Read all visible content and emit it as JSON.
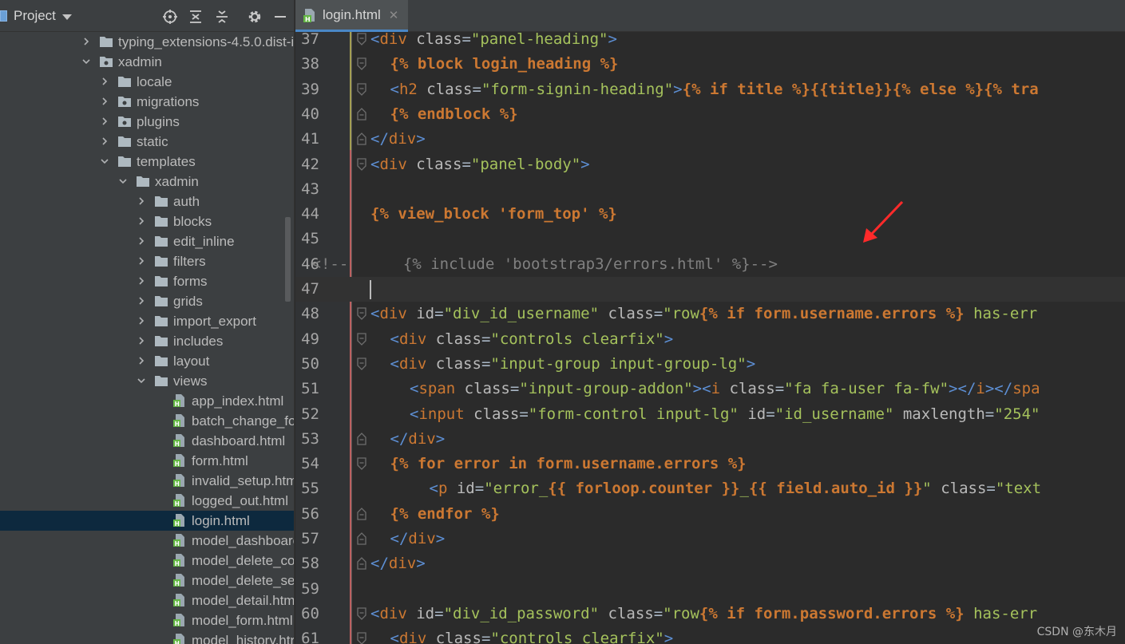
{
  "project_panel": {
    "title": "Project",
    "tree": [
      {
        "label": "typing_extensions-4.5.0.dist-i",
        "kind": "folder",
        "depth": 0,
        "expanded": false
      },
      {
        "label": "xadmin",
        "kind": "package",
        "depth": 0,
        "expanded": true
      },
      {
        "label": "locale",
        "kind": "folder",
        "depth": 1,
        "expanded": false
      },
      {
        "label": "migrations",
        "kind": "package",
        "depth": 1,
        "expanded": false
      },
      {
        "label": "plugins",
        "kind": "package",
        "depth": 1,
        "expanded": false
      },
      {
        "label": "static",
        "kind": "folder",
        "depth": 1,
        "expanded": false
      },
      {
        "label": "templates",
        "kind": "folder",
        "depth": 1,
        "expanded": true
      },
      {
        "label": "xadmin",
        "kind": "folder",
        "depth": 2,
        "expanded": true
      },
      {
        "label": "auth",
        "kind": "folder",
        "depth": 3,
        "expanded": false
      },
      {
        "label": "blocks",
        "kind": "folder",
        "depth": 3,
        "expanded": false
      },
      {
        "label": "edit_inline",
        "kind": "folder",
        "depth": 3,
        "expanded": false
      },
      {
        "label": "filters",
        "kind": "folder",
        "depth": 3,
        "expanded": false
      },
      {
        "label": "forms",
        "kind": "folder",
        "depth": 3,
        "expanded": false
      },
      {
        "label": "grids",
        "kind": "folder",
        "depth": 3,
        "expanded": false
      },
      {
        "label": "import_export",
        "kind": "folder",
        "depth": 3,
        "expanded": false
      },
      {
        "label": "includes",
        "kind": "folder",
        "depth": 3,
        "expanded": false
      },
      {
        "label": "layout",
        "kind": "folder",
        "depth": 3,
        "expanded": false
      },
      {
        "label": "views",
        "kind": "folder",
        "depth": 3,
        "expanded": true
      },
      {
        "label": "app_index.html",
        "kind": "html",
        "depth": 4
      },
      {
        "label": "batch_change_fo",
        "kind": "html",
        "depth": 4
      },
      {
        "label": "dashboard.html",
        "kind": "html",
        "depth": 4
      },
      {
        "label": "form.html",
        "kind": "html",
        "depth": 4
      },
      {
        "label": "invalid_setup.htm",
        "kind": "html",
        "depth": 4
      },
      {
        "label": "logged_out.html",
        "kind": "html",
        "depth": 4
      },
      {
        "label": "login.html",
        "kind": "html",
        "depth": 4,
        "selected": true
      },
      {
        "label": "model_dashboarc",
        "kind": "html",
        "depth": 4
      },
      {
        "label": "model_delete_cor",
        "kind": "html",
        "depth": 4
      },
      {
        "label": "model_delete_sel",
        "kind": "html",
        "depth": 4
      },
      {
        "label": "model_detail.htm",
        "kind": "html",
        "depth": 4
      },
      {
        "label": "model_form.html",
        "kind": "html",
        "depth": 4
      },
      {
        "label": "model_history.htr",
        "kind": "html",
        "depth": 4
      }
    ]
  },
  "editor": {
    "tab_label": "login.html",
    "tab_close": "✕",
    "current_line": 47,
    "lines": [
      {
        "n": "37",
        "indent": 0,
        "tokens": [
          [
            "tag",
            "<"
          ],
          [
            "tag",
            "div"
          ],
          [
            "plain",
            " "
          ],
          [
            "attr",
            "class"
          ],
          [
            "plain",
            "="
          ],
          [
            "str",
            "\"panel-heading\""
          ],
          [
            "tag",
            ">"
          ]
        ]
      },
      {
        "n": "38",
        "indent": 1,
        "tokens": [
          [
            "kw",
            "{% block login_heading %}"
          ]
        ]
      },
      {
        "n": "39",
        "indent": 1,
        "tokens": [
          [
            "tag",
            "<"
          ],
          [
            "tag",
            "h2"
          ],
          [
            "plain",
            " "
          ],
          [
            "attr",
            "class"
          ],
          [
            "plain",
            "="
          ],
          [
            "str",
            "\"form-signin-heading\""
          ],
          [
            "tag",
            ">"
          ],
          [
            "kw",
            "{% if title %}{{title}}{% else %}{% tra"
          ]
        ]
      },
      {
        "n": "40",
        "indent": 1,
        "tokens": [
          [
            "kw",
            "{% endblock %}"
          ]
        ]
      },
      {
        "n": "41",
        "indent": 0,
        "tokens": [
          [
            "tag",
            "</"
          ],
          [
            "tag",
            "div"
          ],
          [
            "tag",
            ">"
          ]
        ]
      },
      {
        "n": "42",
        "indent": 0,
        "tokens": [
          [
            "tag",
            "<"
          ],
          [
            "tag",
            "div"
          ],
          [
            "plain",
            " "
          ],
          [
            "attr",
            "class"
          ],
          [
            "plain",
            "="
          ],
          [
            "str",
            "\"panel-body\""
          ],
          [
            "tag",
            ">"
          ]
        ]
      },
      {
        "n": "43",
        "indent": 0,
        "tokens": []
      },
      {
        "n": "44",
        "indent": 0,
        "tokens": [
          [
            "kw",
            "{% view_block 'form_top' %}"
          ]
        ]
      },
      {
        "n": "45",
        "indent": 0,
        "tokens": []
      },
      {
        "n": "46",
        "indent": -3,
        "tokens": [
          [
            "comment",
            "<!--      {% include 'bootstrap3/errors.html' %}-->"
          ]
        ]
      },
      {
        "n": "47",
        "indent": -3,
        "tokens": []
      },
      {
        "n": "48",
        "indent": 0,
        "tokens": [
          [
            "tag",
            "<"
          ],
          [
            "tag",
            "div"
          ],
          [
            "plain",
            " "
          ],
          [
            "attr",
            "id"
          ],
          [
            "plain",
            "="
          ],
          [
            "str",
            "\"div_id_username\""
          ],
          [
            "plain",
            " "
          ],
          [
            "attr",
            "class"
          ],
          [
            "plain",
            "="
          ],
          [
            "str",
            "\"row"
          ],
          [
            "kw",
            "{% if form.username.errors %}"
          ],
          [
            "str",
            " has-err"
          ]
        ]
      },
      {
        "n": "49",
        "indent": 1,
        "tokens": [
          [
            "tag",
            "<"
          ],
          [
            "tag",
            "div"
          ],
          [
            "plain",
            " "
          ],
          [
            "attr",
            "class"
          ],
          [
            "plain",
            "="
          ],
          [
            "str",
            "\"controls clearfix\""
          ],
          [
            "tag",
            ">"
          ]
        ]
      },
      {
        "n": "50",
        "indent": 1,
        "tokens": [
          [
            "tag",
            "<"
          ],
          [
            "tag",
            "div"
          ],
          [
            "plain",
            " "
          ],
          [
            "attr",
            "class"
          ],
          [
            "plain",
            "="
          ],
          [
            "str",
            "\"input-group input-group-lg\""
          ],
          [
            "tag",
            ">"
          ]
        ]
      },
      {
        "n": "51",
        "indent": 2,
        "tokens": [
          [
            "tag",
            "<"
          ],
          [
            "tag",
            "span"
          ],
          [
            "plain",
            " "
          ],
          [
            "attr",
            "class"
          ],
          [
            "plain",
            "="
          ],
          [
            "str",
            "\"input-group-addon\""
          ],
          [
            "tag",
            ">"
          ],
          [
            "tag",
            "<"
          ],
          [
            "tag",
            "i"
          ],
          [
            "plain",
            " "
          ],
          [
            "attr",
            "class"
          ],
          [
            "plain",
            "="
          ],
          [
            "str",
            "\"fa fa-user fa-fw\""
          ],
          [
            "tag",
            ">"
          ],
          [
            "tag",
            "</"
          ],
          [
            "tag",
            "i"
          ],
          [
            "tag",
            ">"
          ],
          [
            "tag",
            "</"
          ],
          [
            "tag",
            "spa"
          ]
        ]
      },
      {
        "n": "52",
        "indent": 2,
        "tokens": [
          [
            "tag",
            "<"
          ],
          [
            "tag",
            "input"
          ],
          [
            "plain",
            " "
          ],
          [
            "attr",
            "class"
          ],
          [
            "plain",
            "="
          ],
          [
            "str",
            "\"form-control input-lg\""
          ],
          [
            "plain",
            " "
          ],
          [
            "attr",
            "id"
          ],
          [
            "plain",
            "="
          ],
          [
            "str",
            "\"id_username\""
          ],
          [
            "plain",
            " "
          ],
          [
            "attr",
            "maxlength"
          ],
          [
            "plain",
            "="
          ],
          [
            "str",
            "\"254\""
          ]
        ]
      },
      {
        "n": "53",
        "indent": 1,
        "tokens": [
          [
            "tag",
            "</"
          ],
          [
            "tag",
            "div"
          ],
          [
            "tag",
            ">"
          ]
        ]
      },
      {
        "n": "54",
        "indent": 1,
        "tokens": [
          [
            "kw",
            "{% for error in form.username.errors %}"
          ]
        ]
      },
      {
        "n": "55",
        "indent": 3,
        "tokens": [
          [
            "tag",
            "<"
          ],
          [
            "tag",
            "p"
          ],
          [
            "plain",
            " "
          ],
          [
            "attr",
            "id"
          ],
          [
            "plain",
            "="
          ],
          [
            "str",
            "\"error_"
          ],
          [
            "kw",
            "{{ forloop.counter }}"
          ],
          [
            "str",
            "_"
          ],
          [
            "kw",
            "{{ field.auto_id }}"
          ],
          [
            "str",
            "\""
          ],
          [
            "plain",
            " "
          ],
          [
            "attr",
            "class"
          ],
          [
            "plain",
            "="
          ],
          [
            "str",
            "\"text"
          ]
        ]
      },
      {
        "n": "56",
        "indent": 1,
        "tokens": [
          [
            "kw",
            "{% endfor %}"
          ]
        ]
      },
      {
        "n": "57",
        "indent": 1,
        "tokens": [
          [
            "tag",
            "</"
          ],
          [
            "tag",
            "div"
          ],
          [
            "tag",
            ">"
          ]
        ]
      },
      {
        "n": "58",
        "indent": 0,
        "tokens": [
          [
            "tag",
            "</"
          ],
          [
            "tag",
            "div"
          ],
          [
            "tag",
            ">"
          ]
        ]
      },
      {
        "n": "59",
        "indent": 0,
        "tokens": []
      },
      {
        "n": "60",
        "indent": 0,
        "tokens": [
          [
            "tag",
            "<"
          ],
          [
            "tag",
            "div"
          ],
          [
            "plain",
            " "
          ],
          [
            "attr",
            "id"
          ],
          [
            "plain",
            "="
          ],
          [
            "str",
            "\"div_id_password\""
          ],
          [
            "plain",
            " "
          ],
          [
            "attr",
            "class"
          ],
          [
            "plain",
            "="
          ],
          [
            "str",
            "\"row"
          ],
          [
            "kw",
            "{% if form.password.errors %}"
          ],
          [
            "str",
            " has-err"
          ]
        ]
      },
      {
        "n": "61",
        "indent": 1,
        "tokens": [
          [
            "tag",
            "<"
          ],
          [
            "tag",
            "div"
          ],
          [
            "plain",
            " "
          ],
          [
            "attr",
            "class"
          ],
          [
            "plain",
            "="
          ],
          [
            "str",
            "\"controls clearfix\""
          ],
          [
            "tag",
            ">"
          ]
        ]
      }
    ]
  },
  "watermark": "CSDN @东木月",
  "colors": {
    "tag_delim": "#e8bf6a",
    "attr": "#bababa",
    "string": "#a5c25c",
    "template": "#cc7832",
    "comment": "#808080",
    "selection": "#0d293e",
    "annotation_arrow": "#ff2a2a"
  }
}
